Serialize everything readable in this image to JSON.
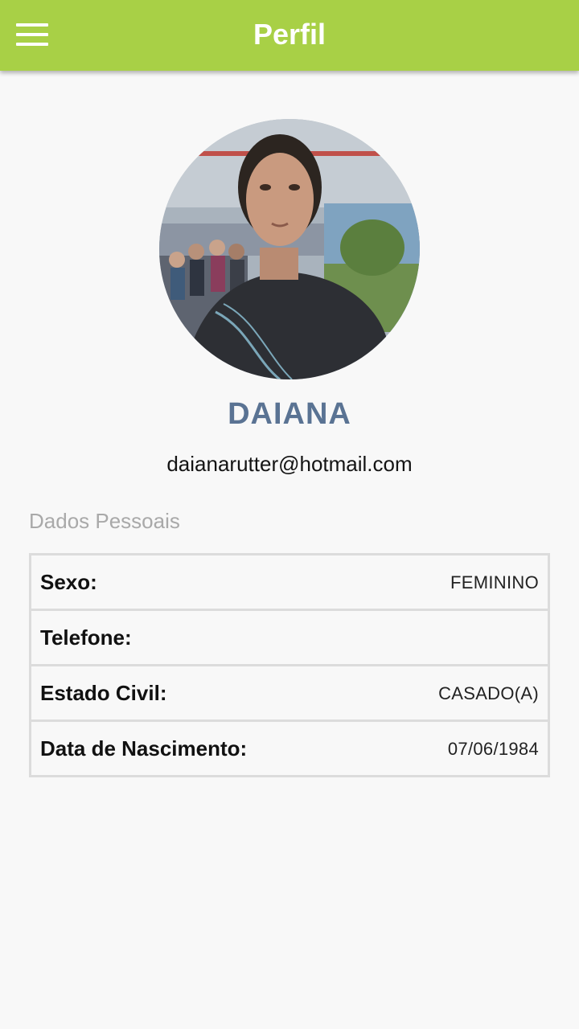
{
  "appbar": {
    "title": "Perfil",
    "menu_icon": "hamburger-menu-icon",
    "color": "#a8d046"
  },
  "profile": {
    "name": "DAIANA",
    "email": "daianarutter@hotmail.com",
    "name_color": "#5a7393"
  },
  "personal_data": {
    "section_title": "Dados Pessoais",
    "rows": [
      {
        "label": "Sexo:",
        "value": "FEMININO"
      },
      {
        "label": "Telefone:",
        "value": ""
      },
      {
        "label": "Estado Civil:",
        "value": "CASADO(A)"
      },
      {
        "label": "Data de Nascimento:",
        "value": "07/06/1984"
      }
    ]
  }
}
